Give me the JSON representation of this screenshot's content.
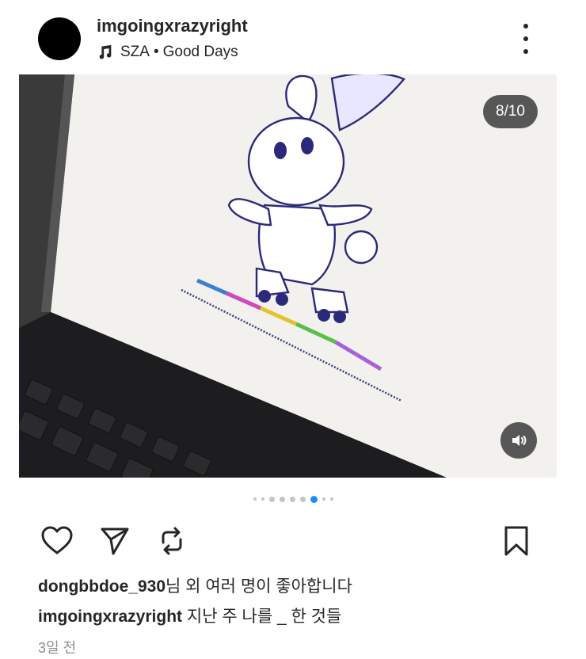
{
  "post": {
    "username": "imgoingxrazyright",
    "music": {
      "artist": "SZA",
      "separator": "•",
      "song": "Good Days",
      "icon": "music-note-icon"
    },
    "more_icon": "more-vertical-icon"
  },
  "media": {
    "counter": "8/10",
    "sound_icon": "speaker-icon",
    "carousel": {
      "total_visible_dots": 9,
      "active_index": 6
    }
  },
  "actions": {
    "like_icon": "heart-icon",
    "share_icon": "send-icon",
    "repost_icon": "repost-icon",
    "save_icon": "bookmark-icon"
  },
  "likes": {
    "name": "dongbbdoe_930",
    "suffix": "님 외 여러 명이 좋아합니다"
  },
  "caption": {
    "username": "imgoingxrazyright",
    "text": "지난 주 나를 _ 한 것들"
  },
  "timestamp": "3일 전",
  "colors": {
    "accent_dot": "#1c8ef0",
    "text": "#262626",
    "muted": "#8e8e8e"
  }
}
